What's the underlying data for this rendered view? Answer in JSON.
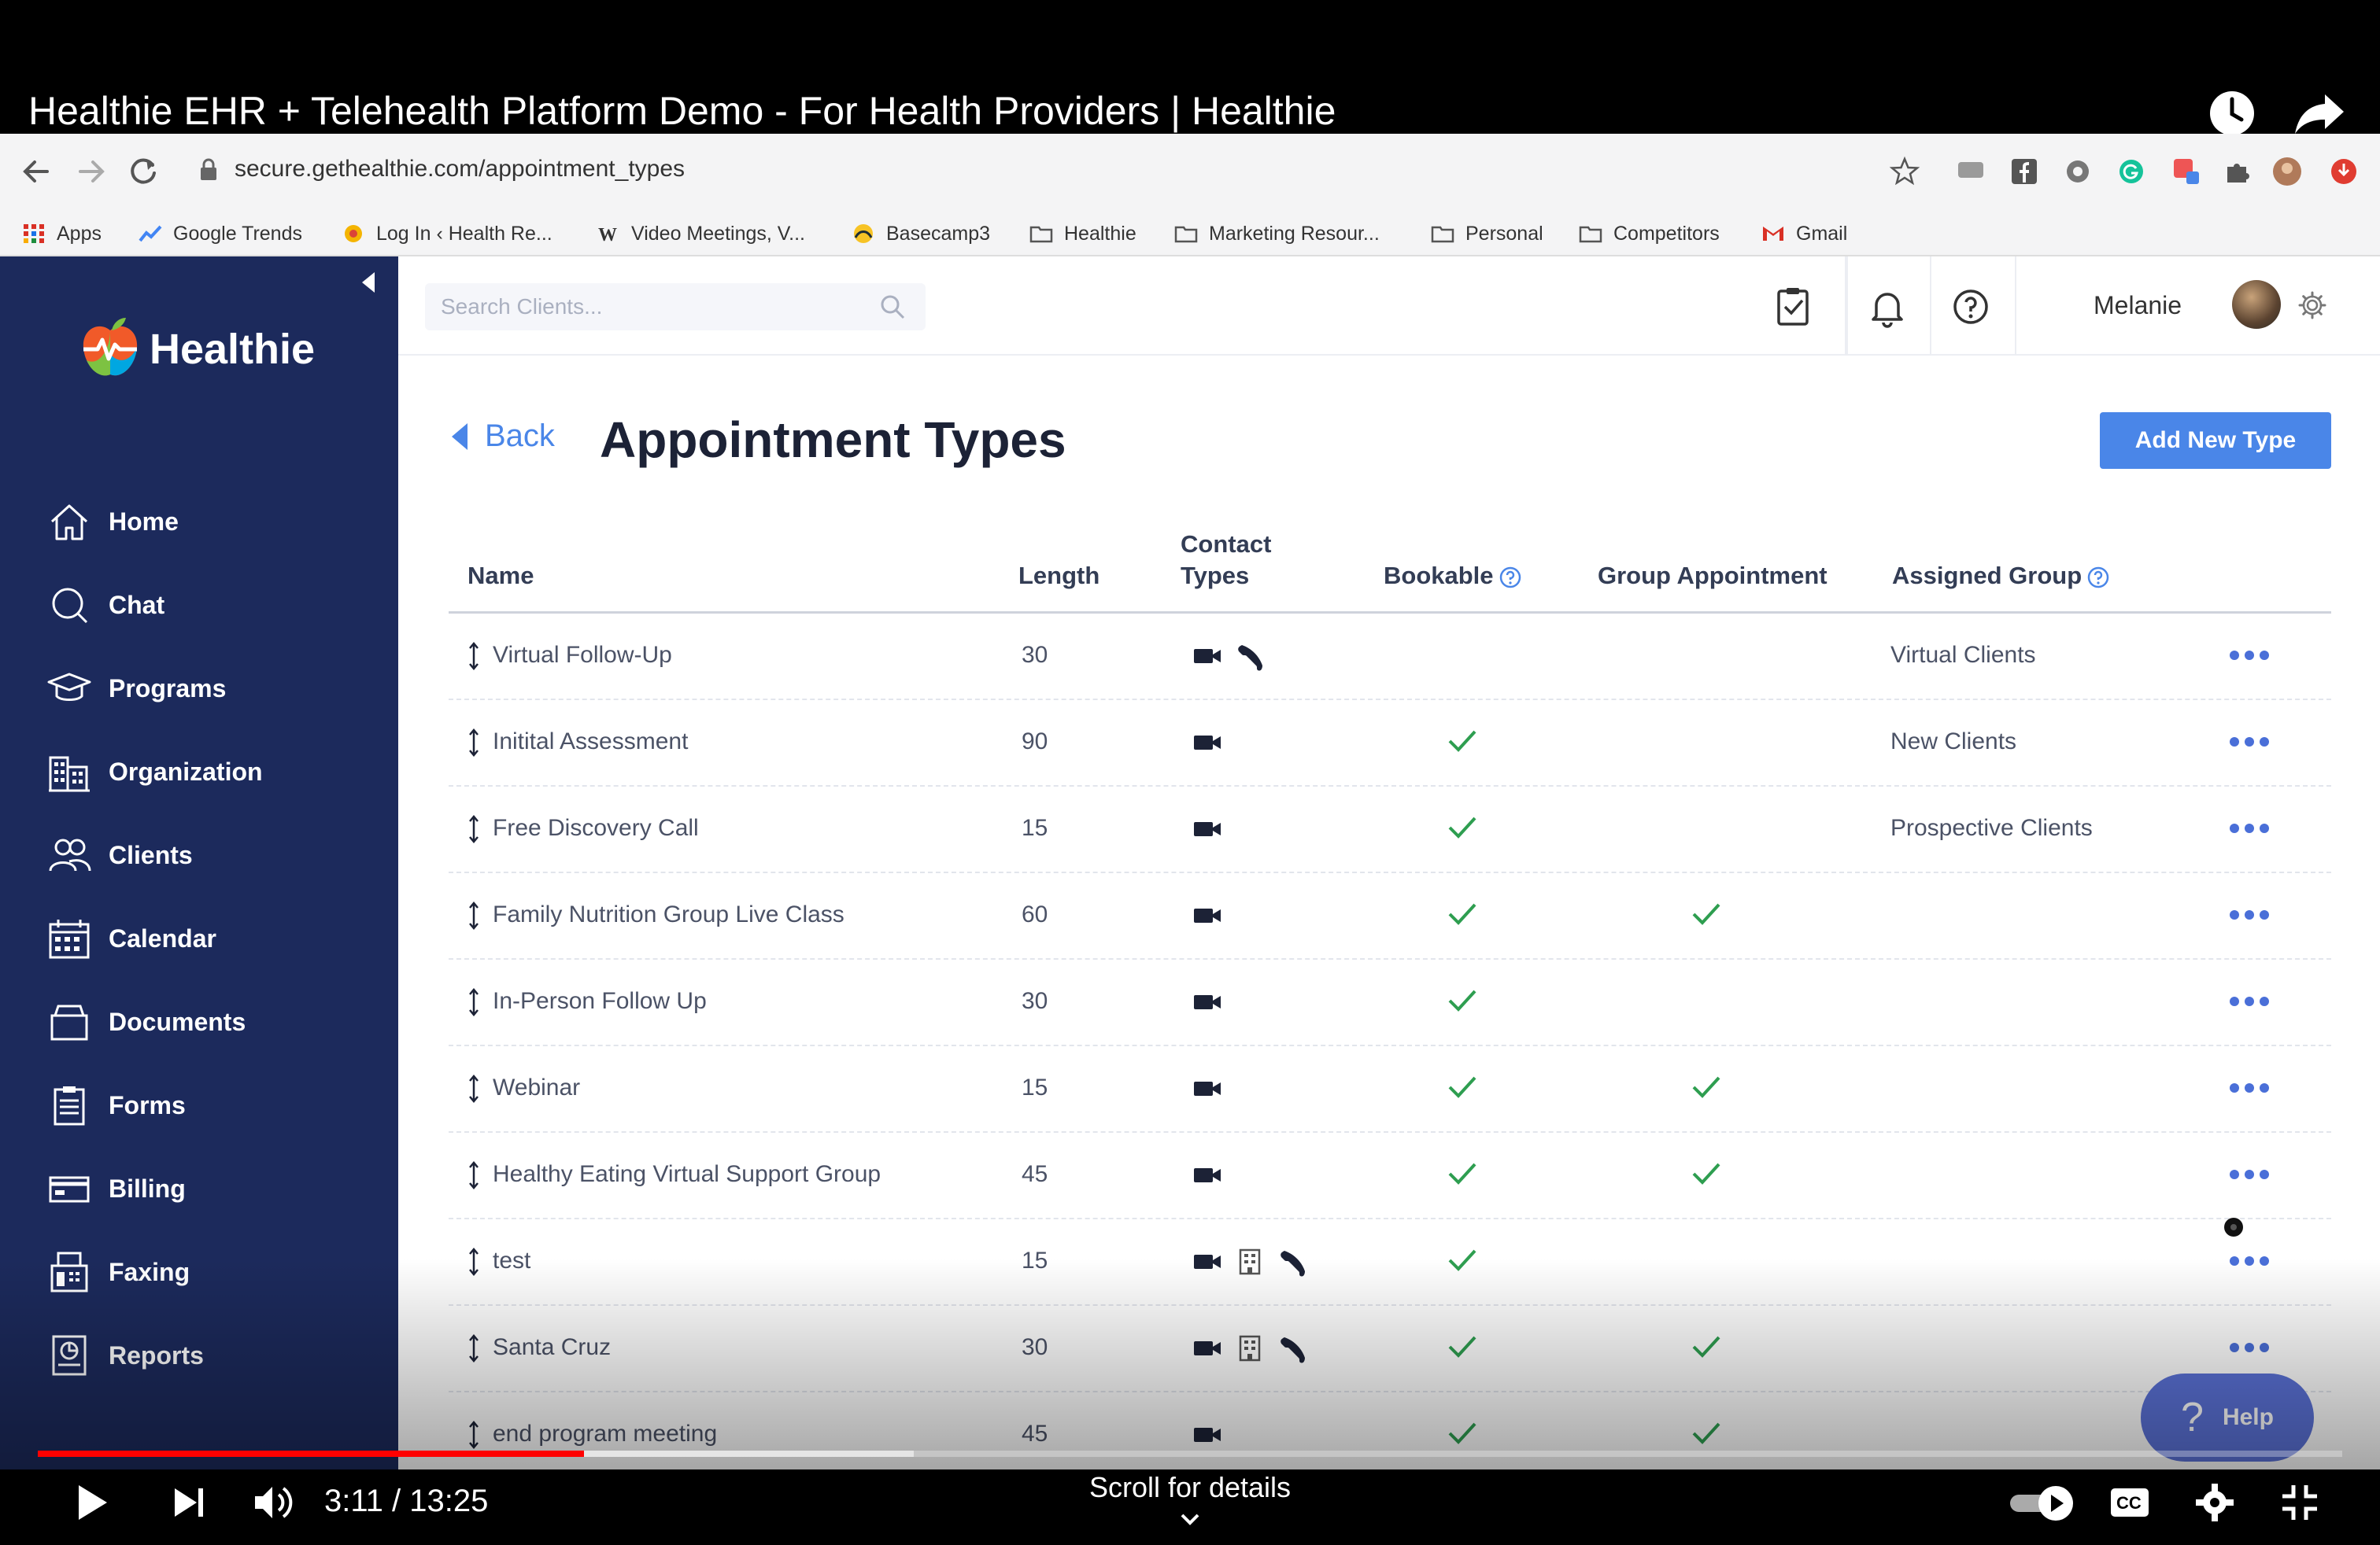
{
  "video": {
    "title": "Healthie EHR + Telehealth Platform Demo - For Health Providers | Healthie",
    "time": "3:11 / 13:25",
    "progress_played_fraction": 0.237,
    "progress_buffered_fraction": 0.38,
    "scroll_hint": "Scroll for details"
  },
  "browser": {
    "url": "secure.gethealthie.com/appointment_types",
    "bookmarks": [
      {
        "label": "Apps",
        "icon": "apps-grid-icon"
      },
      {
        "label": "Google Trends",
        "icon": "trends-icon"
      },
      {
        "label": "Log In ‹ Health Re...",
        "icon": "site-icon"
      },
      {
        "label": "Video Meetings, V...",
        "icon": "w-icon"
      },
      {
        "label": "Basecamp3",
        "icon": "basecamp-icon"
      },
      {
        "label": "Healthie",
        "icon": "folder-icon"
      },
      {
        "label": "Marketing Resour...",
        "icon": "folder-icon"
      },
      {
        "label": "Personal",
        "icon": "folder-icon"
      },
      {
        "label": "Competitors",
        "icon": "folder-icon"
      },
      {
        "label": "Gmail",
        "icon": "gmail-icon"
      }
    ]
  },
  "app": {
    "logo_text": "Healthie",
    "nav": [
      {
        "label": "Home",
        "icon": "home-icon"
      },
      {
        "label": "Chat",
        "icon": "chat-icon"
      },
      {
        "label": "Programs",
        "icon": "graduation-cap-icon"
      },
      {
        "label": "Organization",
        "icon": "building-icon"
      },
      {
        "label": "Clients",
        "icon": "users-icon"
      },
      {
        "label": "Calendar",
        "icon": "calendar-icon"
      },
      {
        "label": "Documents",
        "icon": "documents-icon"
      },
      {
        "label": "Forms",
        "icon": "clipboard-icon"
      },
      {
        "label": "Billing",
        "icon": "billing-icon"
      },
      {
        "label": "Faxing",
        "icon": "fax-icon"
      },
      {
        "label": "Reports",
        "icon": "reports-icon"
      }
    ],
    "search_placeholder": "Search Clients...",
    "user_name": "Melanie",
    "back_label": "Back",
    "page_title": "Appointment Types",
    "add_button": "Add New Type",
    "help_button": "Help",
    "accent_color": "#4a86e8",
    "sidebar_color": "#1c2a5c"
  },
  "table": {
    "headers": {
      "name": "Name",
      "length": "Length",
      "contact_types_1": "Contact",
      "contact_types_2": "Types",
      "bookable": "Bookable",
      "group_appointment": "Group Appointment",
      "assigned_group": "Assigned Group"
    },
    "rows": [
      {
        "name": "Virtual Follow-Up",
        "length": "30",
        "contact": [
          "video",
          "phone"
        ],
        "bookable": false,
        "group": false,
        "assigned_group": "Virtual Clients"
      },
      {
        "name": "Initital Assessment",
        "length": "90",
        "contact": [
          "video"
        ],
        "bookable": true,
        "group": false,
        "assigned_group": "New Clients"
      },
      {
        "name": "Free Discovery Call",
        "length": "15",
        "contact": [
          "video"
        ],
        "bookable": true,
        "group": false,
        "assigned_group": "Prospective Clients"
      },
      {
        "name": "Family Nutrition Group Live Class",
        "length": "60",
        "contact": [
          "video"
        ],
        "bookable": true,
        "group": true,
        "assigned_group": ""
      },
      {
        "name": "In-Person Follow Up",
        "length": "30",
        "contact": [
          "video"
        ],
        "bookable": true,
        "group": false,
        "assigned_group": ""
      },
      {
        "name": "Webinar",
        "length": "15",
        "contact": [
          "video"
        ],
        "bookable": true,
        "group": true,
        "assigned_group": ""
      },
      {
        "name": "Healthy Eating Virtual Support Group",
        "length": "45",
        "contact": [
          "video"
        ],
        "bookable": true,
        "group": true,
        "assigned_group": ""
      },
      {
        "name": "test",
        "length": "15",
        "contact": [
          "video",
          "building",
          "phone"
        ],
        "bookable": true,
        "group": false,
        "assigned_group": ""
      },
      {
        "name": "Santa Cruz",
        "length": "30",
        "contact": [
          "video",
          "building",
          "phone"
        ],
        "bookable": true,
        "group": true,
        "assigned_group": ""
      },
      {
        "name": "end program meeting",
        "length": "45",
        "contact": [
          "video"
        ],
        "bookable": true,
        "group": true,
        "assigned_group": ""
      }
    ]
  }
}
